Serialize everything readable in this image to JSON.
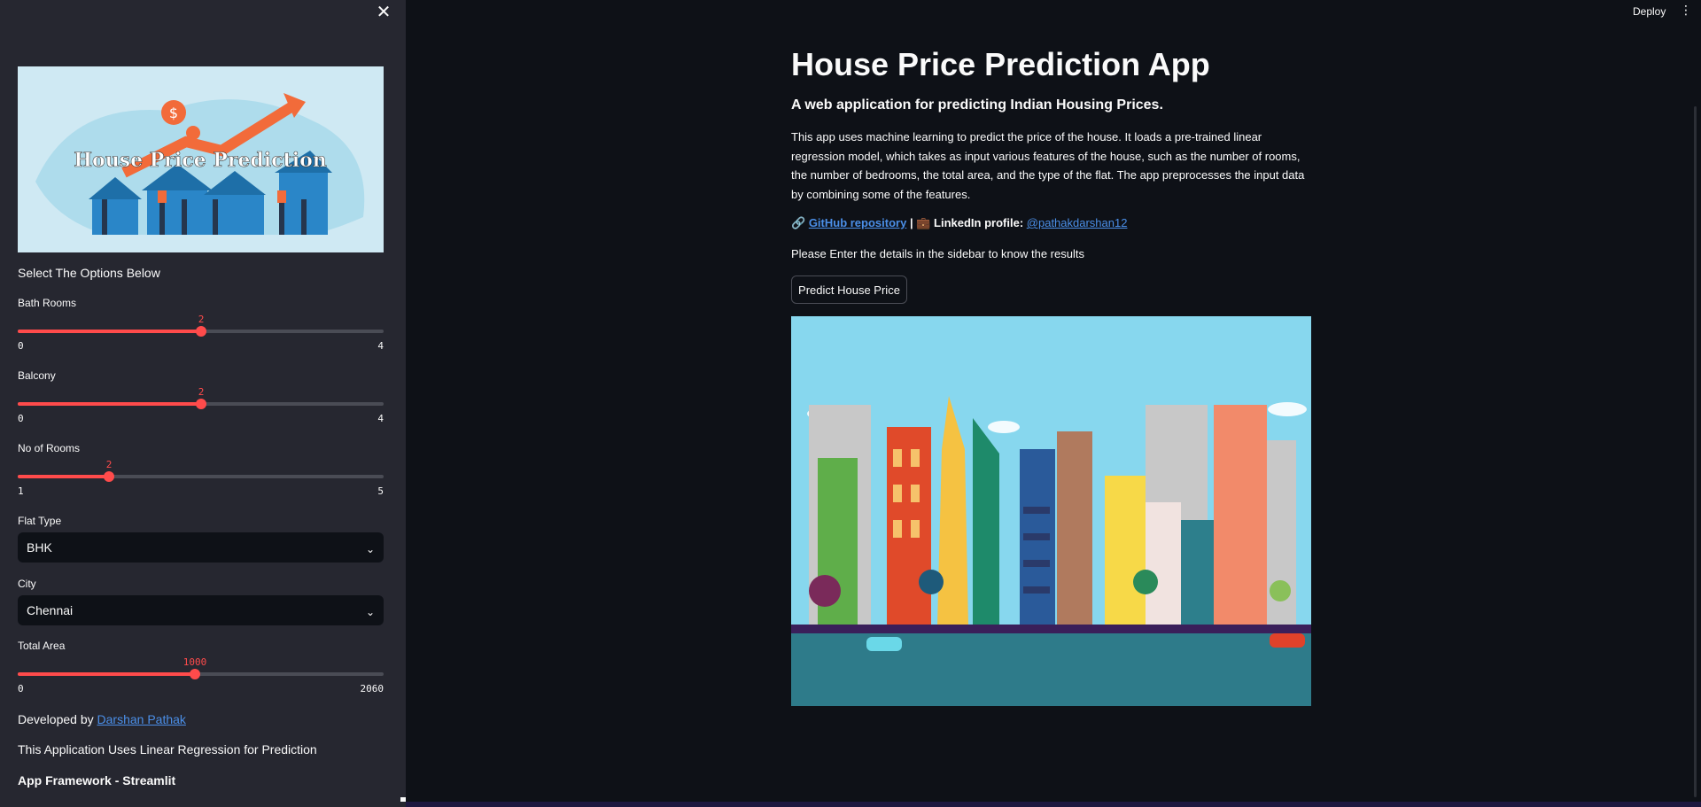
{
  "sidebar": {
    "banner_text": "House Price Prediction",
    "heading": "Select The Options Below",
    "bath_rooms": {
      "label": "Bath Rooms",
      "value": "2",
      "min": "0",
      "max": "4",
      "fraction": 0.5
    },
    "balcony": {
      "label": "Balcony",
      "value": "2",
      "min": "0",
      "max": "4",
      "fraction": 0.5
    },
    "rooms": {
      "label": "No of Rooms",
      "value": "2",
      "min": "1",
      "max": "5",
      "fraction": 0.25
    },
    "flat_type": {
      "label": "Flat Type",
      "value": "BHK"
    },
    "city": {
      "label": "City",
      "value": "Chennai"
    },
    "total_area": {
      "label": "Total Area",
      "value": "1000",
      "min": "0",
      "max": "2060",
      "fraction": 0.485
    },
    "developed_by": "Developed by",
    "developer_name": "Darshan Pathak",
    "uses_text": "This Application Uses Linear Regression for Prediction",
    "framework_text": "App Framework - Streamlit"
  },
  "header": {
    "deploy_label": "Deploy",
    "menu_icon": "more-vertical-icon"
  },
  "main": {
    "title": "House Price Prediction App",
    "subtitle": "A web application for predicting Indian Housing Prices.",
    "description": "This app uses machine learning to predict the price of the house. It loads a pre-trained linear regression model, which takes as input various features of the house, such as the number of rooms, the number of bedrooms, the total area, and the type of the flat. The app preprocesses the input data by combining some of the features.",
    "link_emoji": "🔗",
    "github_label": "GitHub repository",
    "separator": "|",
    "briefcase_emoji": "💼",
    "linkedin_label": "LinkedIn profile:",
    "linkedin_handle": "@pathakdarshan12",
    "instruction": "Please Enter the details in the sidebar to know the results",
    "predict_button": "Predict House Price"
  },
  "colors": {
    "accent": "#ff4b4b",
    "link": "#4b8fe8",
    "sidebar_bg": "#262730",
    "main_bg": "#0e1117"
  }
}
